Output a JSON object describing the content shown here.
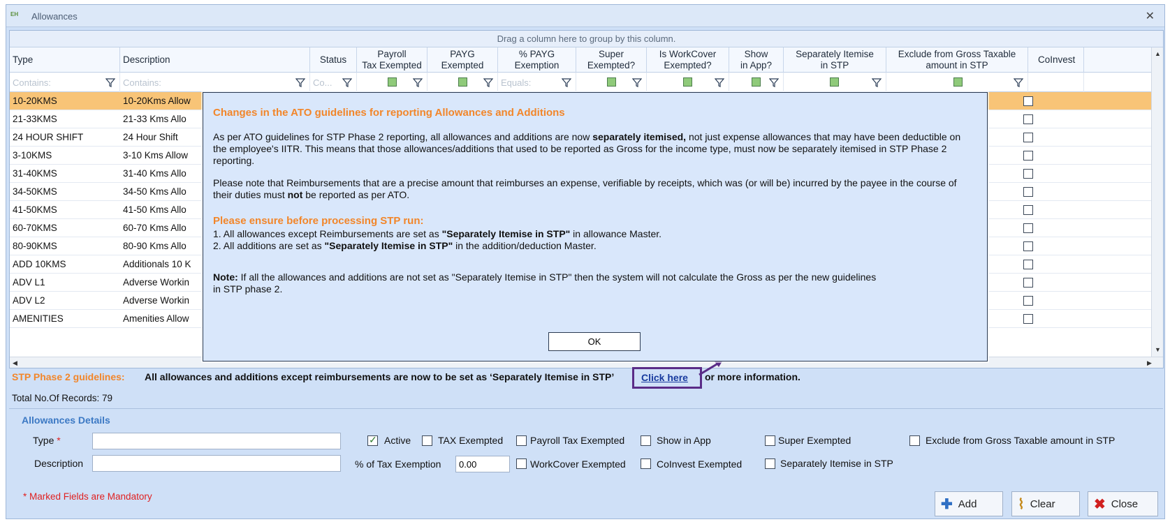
{
  "window": {
    "title": "Allowances",
    "close": "✕",
    "logo": "EH"
  },
  "grid": {
    "group_hint": "Drag a column here to group by this column.",
    "columns": {
      "type": "Type",
      "description": "Description",
      "status": "Status",
      "payroll_tax": [
        "Payroll",
        "Tax Exempted"
      ],
      "payg": [
        "PAYG",
        "Exempted"
      ],
      "pct_payg": [
        "% PAYG",
        "Exemption"
      ],
      "super": [
        "Super",
        "Exempted?"
      ],
      "workcover": [
        "Is WorkCover",
        "Exempted?"
      ],
      "show_app": [
        "Show",
        "in App?"
      ],
      "sep_itemise": [
        "Separately Itemise",
        "in STP"
      ],
      "exclude_gross": [
        "Exclude from Gross Taxable",
        "amount in STP"
      ],
      "coinvest": "CoInvest"
    },
    "filters": {
      "type": "Contains:",
      "description": "Contains:",
      "status": "Co...",
      "pct_payg": "Equals:"
    },
    "rows": [
      {
        "type": "10-20KMS",
        "description": "10-20Kms Allow"
      },
      {
        "type": "21-33KMS",
        "description": "21-33 Kms Allo"
      },
      {
        "type": "24 HOUR SHIFT",
        "description": "24 Hour Shift"
      },
      {
        "type": "3-10KMS",
        "description": "3-10 Kms Allow"
      },
      {
        "type": "31-40KMS",
        "description": "31-40 Kms Allo"
      },
      {
        "type": "34-50KMS",
        "description": "34-50 Kms Allo"
      },
      {
        "type": "41-50KMS",
        "description": "41-50 Kms Allo"
      },
      {
        "type": "60-70KMS",
        "description": "60-70 Kms Allo"
      },
      {
        "type": "80-90KMS",
        "description": "80-90 Kms Allo"
      },
      {
        "type": "ADD 10KMS",
        "description": "Additionals 10 K"
      },
      {
        "type": "ADV L1",
        "description": "Adverse Workin"
      },
      {
        "type": "ADV L2",
        "description": "Adverse Workin"
      },
      {
        "type": "AMENITIES",
        "description": "Amenities Allow"
      }
    ]
  },
  "stp": {
    "label": "STP Phase 2 guidelines:",
    "text": "All allowances and additions except reimbursements are now to be set as ‘Separately Itemise in STP’",
    "link": "Click  here",
    "more": "or more information."
  },
  "records": "Total No.Of Records: 79",
  "details": {
    "title": "Allowances  Details",
    "type_label": "Type",
    "required_mark": "*",
    "description_label": "Description",
    "active": "Active",
    "tax_exempted": "TAX Exempted",
    "payroll_tax_exempted": "Payroll Tax Exempted",
    "show_in_app": "Show in App",
    "super_exempted": "Super Exempted",
    "exclude_gross": "Exclude from Gross Taxable amount in STP",
    "pct_tax_exemption": "% of Tax Exemption",
    "pct_value": "0.00",
    "workcover_exempted": "WorkCover Exempted",
    "coinvest_exempted": "CoInvest Exempted",
    "sep_itemise": "Separately Itemise in STP"
  },
  "footer": {
    "mandatory": "* Marked Fields are Mandatory",
    "add": "Add",
    "clear": "Clear",
    "close": "Close"
  },
  "modal": {
    "title": "Changes in the ATO guidelines for reporting Allowances and Additions",
    "p1_a": "As per ATO guidelines for STP Phase 2 reporting, all allowances and additions are now ",
    "p1_b": "separately itemised,",
    "p1_c": " not just expense allowances that may have been deductible on the employee's IITR. This means that those allowances/additions that used to be reported as Gross for the income type, must now be separately itemised in STP Phase 2 reporting.",
    "p2_a": "Please note that Reimbursements that are a precise amount that reimburses an expense, verifiable by receipts, which was (or will be) incurred by the payee in the course of their duties must ",
    "p2_b": "not",
    "p2_c": " be reported as per ATO.",
    "sub": "Please ensure before processing STP run:",
    "l1_a": "1. All allowances except Reimbursements are set as ",
    "l1_b": "\"Separately Itemise in STP\"",
    "l1_c": " in allowance Master.",
    "l2_a": "2. All additions are set as ",
    "l2_b": "\"Separately Itemise in STP\"",
    "l2_c": " in the addition/deduction Master.",
    "note_a": "Note:",
    "note_b": " If all the allowances and additions are not set as \"Separately Itemise in STP\" then the system will not calculate the Gross as per the new guidelines in STP phase 2.",
    "ok": "OK"
  },
  "colors": {
    "accent_orange": "#f2862a",
    "selected_row": "#f8c477",
    "link": "#173a9e",
    "highlight_box": "#5a2c87"
  }
}
